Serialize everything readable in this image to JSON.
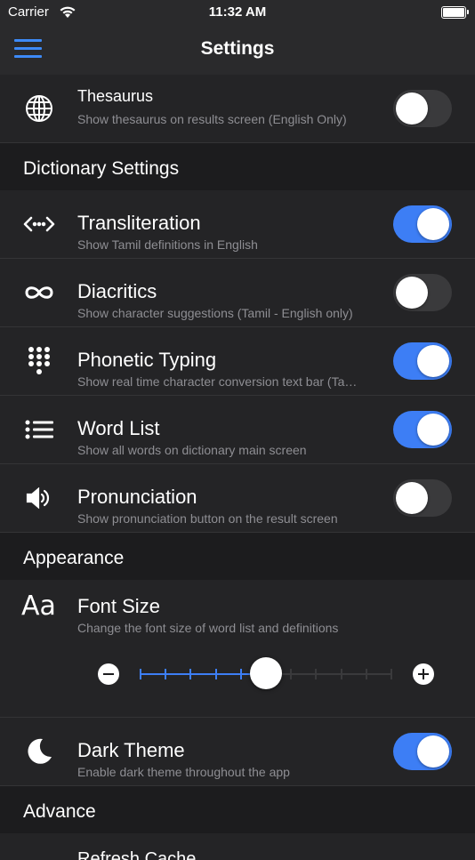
{
  "status": {
    "carrier": "Carrier",
    "time": "11:32 AM"
  },
  "nav": {
    "title": "Settings"
  },
  "thesaurus": {
    "title": "Thesaurus",
    "subtitle": "Show thesaurus on results screen (English Only)",
    "enabled": false
  },
  "sections": {
    "dictionary": "Dictionary Settings",
    "appearance": "Appearance",
    "advance": "Advance"
  },
  "dictionary_items": [
    {
      "icon": "code-arrows-icon",
      "title": "Transliteration",
      "subtitle": "Show Tamil definitions in English",
      "enabled": true
    },
    {
      "icon": "infinity-icon",
      "title": "Diacritics",
      "subtitle": "Show character suggestions (Tamil - English only)",
      "enabled": false
    },
    {
      "icon": "keypad-icon",
      "title": "Phonetic Typing",
      "subtitle": "Show real time character conversion text bar (Tamil - English only)",
      "enabled": true
    },
    {
      "icon": "list-icon",
      "title": "Word List",
      "subtitle": "Show all words on dictionary main screen",
      "enabled": true
    },
    {
      "icon": "speaker-icon",
      "title": "Pronunciation",
      "subtitle": "Show pronunciation button on the result screen",
      "enabled": false
    }
  ],
  "font_size": {
    "icon_text": "Aa",
    "title": "Font Size",
    "subtitle": "Change the font size of word list and definitions",
    "level": 5,
    "max_level": 10
  },
  "dark_theme": {
    "title": "Dark Theme",
    "subtitle": "Enable dark theme throughout the app",
    "enabled": true
  },
  "advance_items": [
    {
      "title": "Refresh Cache"
    }
  ],
  "colors": {
    "accent": "#3d7ef5",
    "background": "#1c1c1e",
    "cell": "#242426"
  }
}
